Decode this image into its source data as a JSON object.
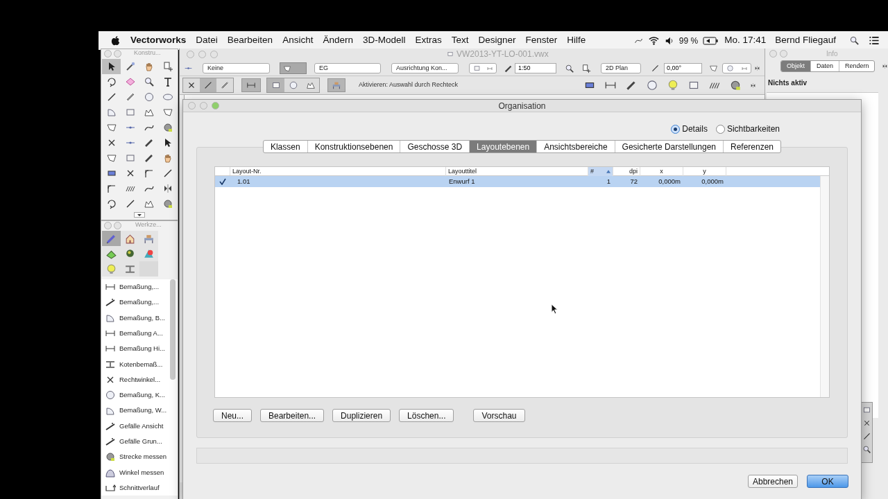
{
  "menu_bar": {
    "app": "Vectorworks",
    "menus": [
      "Datei",
      "Bearbeiten",
      "Ansicht",
      "Ändern",
      "3D-Modell",
      "Extras",
      "Text",
      "Designer",
      "Fenster",
      "Hilfe"
    ],
    "battery": "99 %",
    "clock": "Mo. 17:41",
    "user": "Bernd Fliegauf"
  },
  "construction_palette": {
    "title": "Konstru..."
  },
  "tool_set_palette": {
    "title": "Werkze...",
    "sets": [
      {
        "selected": true
      },
      {
        "selected": false
      },
      {
        "selected": false
      },
      {
        "selected": false
      },
      {
        "selected": false
      },
      {
        "selected": false
      },
      {
        "selected": false
      },
      {
        "selected": false
      }
    ],
    "tools": [
      {
        "label": "Bemaßung,..."
      },
      {
        "label": "Bemaßung,..."
      },
      {
        "label": "Bemaßung, B..."
      },
      {
        "label": "Bemaßung A..."
      },
      {
        "label": "Bemaßung Hi..."
      },
      {
        "label": "Kotenbemaß..."
      },
      {
        "label": "Rechtwinkel..."
      },
      {
        "label": "Bemaßung, K..."
      },
      {
        "label": "Bemaßung, W..."
      },
      {
        "label": "Gefälle Ansicht"
      },
      {
        "label": "Gefälle Grun..."
      },
      {
        "label": "Strecke messen"
      },
      {
        "label": "Winkel messen"
      },
      {
        "label": "Schnittverlauf"
      }
    ]
  },
  "document_window": {
    "title": "VW2013-YT-LO-001.vwx",
    "class_popup": "Keine",
    "layer_popup": "EG",
    "snap_popup": "Ausrichtung Kon...",
    "scale": "1:50",
    "view_popup": "2D Plan",
    "rotation": "0,00°",
    "mode_hint": "Aktivieren: Auswahl durch Rechteck"
  },
  "info_palette": {
    "title": "Info",
    "tabs": [
      {
        "label": "Objekt",
        "selected": true
      },
      {
        "label": "Daten",
        "selected": false
      },
      {
        "label": "Rendern",
        "selected": false
      }
    ],
    "status": "Nichts aktiv"
  },
  "dialog": {
    "title": "Organisation",
    "view_options": [
      {
        "label": "Details",
        "selected": true
      },
      {
        "label": "Sichtbarkeiten",
        "selected": false
      }
    ],
    "tabs": [
      {
        "label": "Klassen",
        "selected": false
      },
      {
        "label": "Konstruktionsebenen",
        "selected": false
      },
      {
        "label": "Geschosse 3D",
        "selected": false
      },
      {
        "label": "Layoutebenen",
        "selected": true
      },
      {
        "label": "Ansichtsbereiche",
        "selected": false
      },
      {
        "label": "Gesicherte Darstellungen",
        "selected": false
      },
      {
        "label": "Referenzen",
        "selected": false
      }
    ],
    "table": {
      "columns": [
        {
          "label": "Layout-Nr.",
          "sorted": false
        },
        {
          "label": "Layouttitel",
          "sorted": false
        },
        {
          "label": "#",
          "sorted": true
        },
        {
          "label": "dpi",
          "sorted": false
        },
        {
          "label": "x",
          "sorted": false
        },
        {
          "label": "y",
          "sorted": false
        }
      ],
      "rows": [
        {
          "selected": true,
          "checked": true,
          "cells": [
            "1.01",
            "Enwurf 1",
            "1",
            "72",
            "0,000m",
            "0,000m"
          ]
        }
      ]
    },
    "buttons": [
      "Neu...",
      "Bearbeiten...",
      "Duplizieren",
      "Löschen...",
      "Vorschau"
    ],
    "footer_buttons": [
      {
        "label": "Abbrechen",
        "default": false
      },
      {
        "label": "OK",
        "default": true
      }
    ]
  }
}
